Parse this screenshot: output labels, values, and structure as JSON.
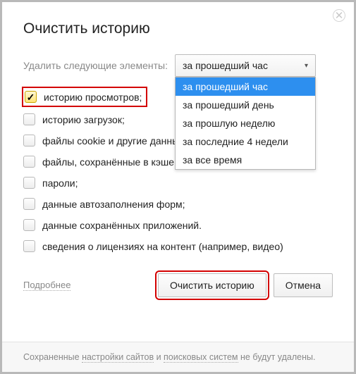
{
  "title": "Очистить историю",
  "selectRow": {
    "label": "Удалить следующие элементы:",
    "selected": "за прошедший час",
    "options": [
      "за прошедший час",
      "за прошедший день",
      "за прошлую неделю",
      "за последние 4 недели",
      "за все время"
    ]
  },
  "checks": [
    {
      "label": "историю просмотров;",
      "checked": true,
      "highlighted": true
    },
    {
      "label": "историю загрузок;",
      "checked": false,
      "highlighted": false
    },
    {
      "label": "файлы cookie и другие данные сайтов и модулей",
      "checked": false,
      "highlighted": false
    },
    {
      "label": "файлы, сохранённые в кэше;",
      "checked": false,
      "highlighted": false
    },
    {
      "label": "пароли;",
      "checked": false,
      "highlighted": false
    },
    {
      "label": "данные автозаполнения форм;",
      "checked": false,
      "highlighted": false
    },
    {
      "label": "данные сохранённых приложений.",
      "checked": false,
      "highlighted": false
    },
    {
      "label": "сведения о лицензиях на контент (например, видео)",
      "checked": false,
      "highlighted": false
    }
  ],
  "footer": {
    "more": "Подробнее",
    "clear": "Очистить историю",
    "cancel": "Отмена"
  },
  "note": {
    "pre": "Сохраненные ",
    "link1": "настройки сайтов",
    "mid": " и ",
    "link2": "поисковых систем",
    "post": " не будут удалены."
  }
}
